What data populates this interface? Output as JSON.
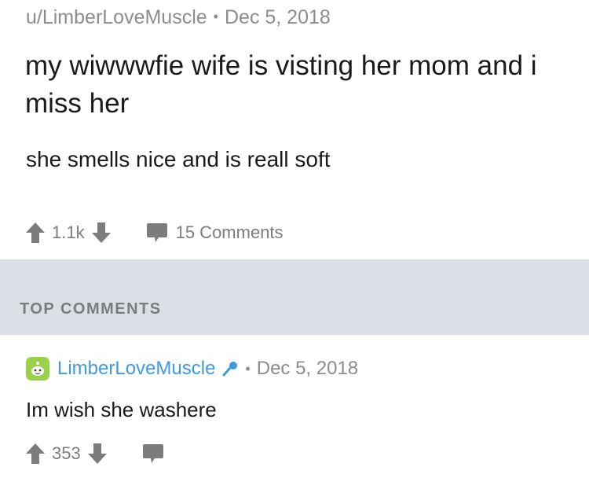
{
  "post": {
    "author": "u/LimberLoveMuscle",
    "separator": "•",
    "date": "Dec 5, 2018",
    "title": "my wiwwwfie wife is visting her mom and i miss her",
    "body": "she smells nice and is reall soft",
    "score": "1.1k",
    "comments_label": "15 Comments"
  },
  "section": {
    "header": "TOP COMMENTS"
  },
  "comment": {
    "author": "LimberLoveMuscle",
    "separator": "•",
    "date": "Dec 5, 2018",
    "body": "Im wish she washere",
    "score": "353"
  },
  "colors": {
    "author_link": "#3f9ae0",
    "muted_text": "#8a8d90",
    "section_bg": "#dae0e6",
    "icon_gray": "#7c7c7c",
    "avatar_green": "#9bd04a"
  },
  "icons": {
    "upvote": "arrow-up-icon",
    "downvote": "arrow-down-icon",
    "comment": "speech-bubble-icon",
    "avatar": "snoo-avatar-icon",
    "moderator": "microphone-icon"
  }
}
